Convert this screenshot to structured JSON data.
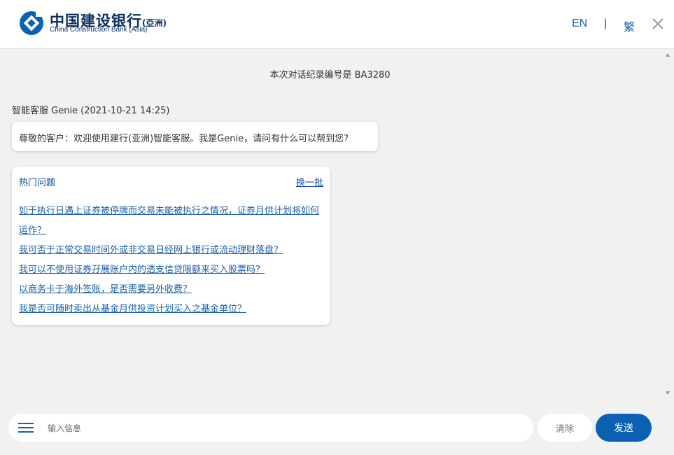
{
  "header": {
    "brand_cn": "中国建设银行",
    "brand_cn_suffix": "(亞洲)",
    "brand_en": "China Construction Bank (Asia)",
    "lang_en": "EN",
    "lang_sep": "|",
    "lang_tc": "繁",
    "brand_color": "#1a5fa5"
  },
  "chat": {
    "record_text": "本次对话纪录编号是 BA3280",
    "sender_line": "智能客服 Genie (2021-10-21 14:25)",
    "welcome_message": "尊敬的客户：欢迎使用建行(亚洲)智能客服。我是Genie，请问有什么可以帮到您?",
    "hot_questions": {
      "title": "热门问题",
      "refresh_label": "换一批",
      "items": [
        "如于执行日遇上证券被停牌而交易未能被执行之情况，证券月供计划将如何运作？",
        "我可否于正常交易时间外或非交易日经网上银行或流动理财落盘？",
        "我可以不使用证券孖展账户内的透支信贷限额来买入股票吗？",
        "以商务卡于海外签账，是否需要另外收费？",
        "我是否可随时卖出从基金月供投资计划买入之基金单位？"
      ]
    }
  },
  "input_bar": {
    "placeholder": "输入信息",
    "value": "",
    "clear_label": "清除",
    "send_label": "发送"
  }
}
